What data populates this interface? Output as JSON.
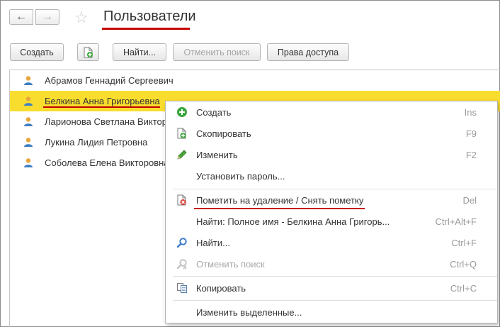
{
  "header": {
    "back_icon": "arrow-left-icon",
    "forward_icon": "arrow-right-icon",
    "favorite_icon": "star-icon",
    "title": "Пользователи"
  },
  "toolbar": {
    "create_label": "Создать",
    "copy_icon": "copy-document-icon",
    "find_label": "Найти...",
    "cancel_search_label": "Отменить поиск",
    "access_rights_label": "Права доступа"
  },
  "list": {
    "items": [
      {
        "name": "Абрамов Геннадий Сергеевич",
        "icon": "user-icon"
      },
      {
        "name": "Белкина Анна Григорьевна",
        "icon": "user-icon",
        "selected": true
      },
      {
        "name": "Ларионова Светлана Виктор",
        "icon": "user-icon"
      },
      {
        "name": "Лукина Лидия Петровна",
        "icon": "user-icon"
      },
      {
        "name": "Соболева Елена Викторовна",
        "icon": "user-icon"
      }
    ]
  },
  "context_menu": {
    "items": [
      {
        "label": "Создать",
        "shortcut": "Ins",
        "icon": "plus-circle-icon"
      },
      {
        "label": "Скопировать",
        "shortcut": "F9",
        "icon": "copy-document-icon"
      },
      {
        "label": "Изменить",
        "shortcut": "F2",
        "icon": "pencil-icon"
      },
      {
        "label": "Установить пароль...",
        "shortcut": ""
      },
      {
        "label": "Пометить на удаление / Снять пометку",
        "shortcut": "Del",
        "icon": "delete-mark-icon"
      },
      {
        "label": "Найти: Полное имя - Белкина Анна Григорь...",
        "shortcut": "Ctrl+Alt+F"
      },
      {
        "label": "Найти...",
        "shortcut": "Ctrl+F",
        "icon": "search-icon"
      },
      {
        "label": "Отменить поиск",
        "shortcut": "Ctrl+Q",
        "icon": "cancel-search-icon",
        "disabled": true
      },
      {
        "label": "Копировать",
        "shortcut": "Ctrl+C",
        "icon": "copy-clipboard-icon"
      },
      {
        "label": "Изменить выделенные...",
        "shortcut": ""
      }
    ]
  },
  "colors": {
    "selection": "#f9dd2e",
    "annotation_underline": "#c40000"
  }
}
